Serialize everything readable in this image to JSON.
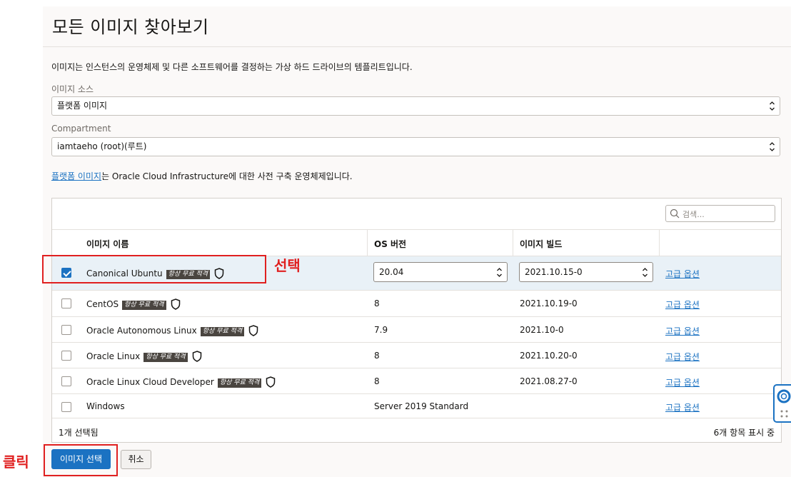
{
  "page": {
    "title": "모든 이미지 찾아보기",
    "description": "이미지는 인스턴스의 운영체제 및 다른 소프트웨어를 결정하는 가상 하드 드라이브의 템플리트입니다."
  },
  "image_source": {
    "label": "이미지 소스",
    "value": "플랫폼 이미지"
  },
  "compartment": {
    "label": "Compartment",
    "value": "iamtaeho (root)(루트)"
  },
  "note": {
    "link": "플랫폼 이미지",
    "text": "는 Oracle Cloud Infrastructure에 대한 사전 구축 운영체제입니다."
  },
  "table": {
    "search_placeholder": "검색...",
    "columns": {
      "name": "이미지 이름",
      "os_version": "OS 버전",
      "build": "이미지 빌드"
    },
    "badge": "항상 무료 적격",
    "link_label": "고급 옵션",
    "rows": [
      {
        "name": "Canonical Ubuntu",
        "os_version": "20.04",
        "build": "2021.10.15-0",
        "selected": true,
        "free": true
      },
      {
        "name": "CentOS",
        "os_version": "8",
        "build": "2021.10.19-0",
        "selected": false,
        "free": true
      },
      {
        "name": "Oracle Autonomous Linux",
        "os_version": "7.9",
        "build": "2021.10-0",
        "selected": false,
        "free": true
      },
      {
        "name": "Oracle Linux",
        "os_version": "8",
        "build": "2021.10.20-0",
        "selected": false,
        "free": true
      },
      {
        "name": "Oracle Linux Cloud Developer",
        "os_version": "8",
        "build": "2021.08.27-0",
        "selected": false,
        "free": true
      },
      {
        "name": "Windows",
        "os_version": "Server 2019 Standard",
        "build": "",
        "selected": false,
        "free": false
      }
    ],
    "selected_count": "1개 선택됨",
    "shown_count": "6개 항목 표시 중"
  },
  "buttons": {
    "select": "이미지 선택",
    "cancel": "취소"
  },
  "annotations": {
    "select_label": "선택",
    "click_label": "클릭",
    "color": "#e02020"
  },
  "colors": {
    "accent": "#1b72c2",
    "selected_row": "#e9f1f7",
    "badge": "#4a4540"
  }
}
